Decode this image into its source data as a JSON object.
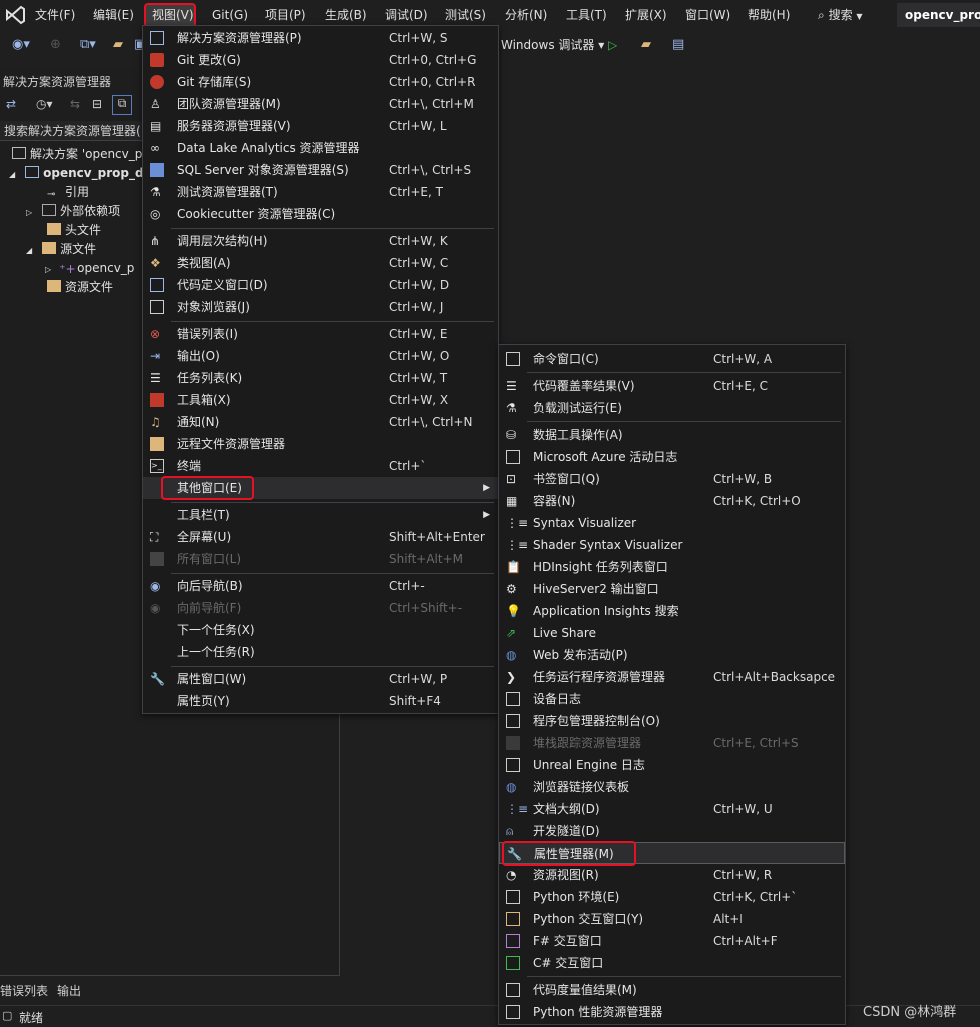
{
  "menubar": {
    "items": [
      "文件(F)",
      "编辑(E)",
      "视图(V)",
      "Git(G)",
      "项目(P)",
      "生成(B)",
      "调试(D)",
      "测试(S)",
      "分析(N)",
      "工具(T)",
      "扩展(X)",
      "窗口(W)",
      "帮助(H)"
    ],
    "search": "搜索",
    "search_icon": "search-icon",
    "project_tab": "opencv_prop"
  },
  "toolbar": {
    "run_label": "Windows 调试器"
  },
  "solution_explorer": {
    "title": "解决方案资源管理器",
    "search_placeholder": "搜索解决方案资源管理器(",
    "tree": [
      "解决方案 'opencv_p",
      "opencv_prop_d",
      "引用",
      "外部依赖项",
      "头文件",
      "源文件",
      "opencv_p",
      "资源文件"
    ]
  },
  "view_menu": {
    "items": [
      {
        "label": "解决方案资源管理器(P)",
        "shortcut": "Ctrl+W, S",
        "icon": "solution-explorer-icon"
      },
      {
        "label": "Git 更改(G)",
        "shortcut": "Ctrl+0, Ctrl+G",
        "icon": "git-changes-icon"
      },
      {
        "label": "Git 存储库(S)",
        "shortcut": "Ctrl+0, Ctrl+R",
        "icon": "git-repo-icon"
      },
      {
        "label": "团队资源管理器(M)",
        "shortcut": "Ctrl+\\, Ctrl+M",
        "icon": "team-explorer-icon"
      },
      {
        "label": "服务器资源管理器(V)",
        "shortcut": "Ctrl+W, L",
        "icon": "server-explorer-icon"
      },
      {
        "label": "Data Lake Analytics 资源管理器",
        "shortcut": "",
        "icon": "data-lake-icon"
      },
      {
        "label": "SQL Server 对象资源管理器(S)",
        "shortcut": "Ctrl+\\, Ctrl+S",
        "icon": "sql-server-icon"
      },
      {
        "label": "测试资源管理器(T)",
        "shortcut": "Ctrl+E, T",
        "icon": "test-explorer-icon"
      },
      {
        "label": "Cookiecutter 资源管理器(C)",
        "shortcut": "",
        "icon": "cookiecutter-icon"
      },
      {
        "label": "调用层次结构(H)",
        "shortcut": "Ctrl+W, K",
        "icon": "call-hierarchy-icon"
      },
      {
        "label": "类视图(A)",
        "shortcut": "Ctrl+W, C",
        "icon": "class-view-icon"
      },
      {
        "label": "代码定义窗口(D)",
        "shortcut": "Ctrl+W, D",
        "icon": "code-definition-icon"
      },
      {
        "label": "对象浏览器(J)",
        "shortcut": "Ctrl+W, J",
        "icon": "object-browser-icon"
      },
      {
        "label": "错误列表(I)",
        "shortcut": "Ctrl+W, E",
        "icon": "error-list-icon"
      },
      {
        "label": "输出(O)",
        "shortcut": "Ctrl+W, O",
        "icon": "output-icon"
      },
      {
        "label": "任务列表(K)",
        "shortcut": "Ctrl+W, T",
        "icon": "task-list-icon"
      },
      {
        "label": "工具箱(X)",
        "shortcut": "Ctrl+W, X",
        "icon": "toolbox-icon"
      },
      {
        "label": "通知(N)",
        "shortcut": "Ctrl+\\, Ctrl+N",
        "icon": "bell-icon"
      },
      {
        "label": "远程文件资源管理器",
        "shortcut": "",
        "icon": "remote-files-icon"
      },
      {
        "label": "终端",
        "shortcut": "Ctrl+`",
        "icon": "terminal-icon"
      },
      {
        "label": "其他窗口(E)",
        "shortcut": "",
        "icon": ""
      },
      {
        "label": "工具栏(T)",
        "shortcut": "",
        "icon": ""
      },
      {
        "label": "全屏幕(U)",
        "shortcut": "Shift+Alt+Enter",
        "icon": "fullscreen-icon"
      },
      {
        "label": "所有窗口(L)",
        "shortcut": "Shift+Alt+M",
        "icon": "all-windows-icon"
      },
      {
        "label": "向后导航(B)",
        "shortcut": "Ctrl+-",
        "icon": "navigate-back-icon"
      },
      {
        "label": "向前导航(F)",
        "shortcut": "Ctrl+Shift+-",
        "icon": "navigate-forward-icon"
      },
      {
        "label": "下一个任务(X)",
        "shortcut": "",
        "icon": ""
      },
      {
        "label": "上一个任务(R)",
        "shortcut": "",
        "icon": ""
      },
      {
        "label": "属性窗口(W)",
        "shortcut": "Ctrl+W, P",
        "icon": "wrench-icon"
      },
      {
        "label": "属性页(Y)",
        "shortcut": "Shift+F4",
        "icon": ""
      }
    ]
  },
  "other_windows_menu": {
    "items": [
      {
        "label": "命令窗口(C)",
        "shortcut": "Ctrl+W, A",
        "icon": "command-window-icon"
      },
      {
        "label": "代码覆盖率结果(V)",
        "shortcut": "Ctrl+E, C",
        "icon": "code-coverage-icon"
      },
      {
        "label": "负载测试运行(E)",
        "shortcut": "",
        "icon": "load-test-icon"
      },
      {
        "label": "数据工具操作(A)",
        "shortcut": "",
        "icon": "data-tools-icon"
      },
      {
        "label": "Microsoft Azure 活动日志",
        "shortcut": "",
        "icon": "azure-log-icon"
      },
      {
        "label": "书签窗口(Q)",
        "shortcut": "Ctrl+W, B",
        "icon": "bookmark-icon"
      },
      {
        "label": "容器(N)",
        "shortcut": "Ctrl+K, Ctrl+O",
        "icon": "container-icon"
      },
      {
        "label": "Syntax Visualizer",
        "shortcut": "",
        "icon": "syntax-visualizer-icon"
      },
      {
        "label": "Shader Syntax Visualizer",
        "shortcut": "",
        "icon": "shader-syntax-icon"
      },
      {
        "label": "HDInsight 任务列表窗口",
        "shortcut": "",
        "icon": "hdinsight-icon"
      },
      {
        "label": "HiveServer2 输出窗口",
        "shortcut": "",
        "icon": "hiveserver-icon"
      },
      {
        "label": "Application Insights 搜索",
        "shortcut": "",
        "icon": "app-insights-icon"
      },
      {
        "label": "Live Share",
        "shortcut": "",
        "icon": "live-share-icon"
      },
      {
        "label": "Web 发布活动(P)",
        "shortcut": "",
        "icon": "web-publish-icon"
      },
      {
        "label": "任务运行程序资源管理器",
        "shortcut": "Ctrl+Alt+Backsapce",
        "icon": "task-runner-icon"
      },
      {
        "label": "设备日志",
        "shortcut": "",
        "icon": "device-log-icon"
      },
      {
        "label": "程序包管理器控制台(O)",
        "shortcut": "",
        "icon": "package-console-icon"
      },
      {
        "label": "堆栈跟踪资源管理器",
        "shortcut": "Ctrl+E, Ctrl+S",
        "icon": "stack-trace-icon"
      },
      {
        "label": "Unreal Engine 日志",
        "shortcut": "",
        "icon": "unreal-log-icon"
      },
      {
        "label": "浏览器链接仪表板",
        "shortcut": "",
        "icon": "browser-link-icon"
      },
      {
        "label": "文档大纲(D)",
        "shortcut": "Ctrl+W, U",
        "icon": "document-outline-icon"
      },
      {
        "label": "开发隧道(D)",
        "shortcut": "",
        "icon": "dev-tunnel-icon"
      },
      {
        "label": "属性管理器(M)",
        "shortcut": "",
        "icon": "wrench-icon"
      },
      {
        "label": "资源视图(R)",
        "shortcut": "Ctrl+W, R",
        "icon": "resource-view-icon"
      },
      {
        "label": "Python 环境(E)",
        "shortcut": "Ctrl+K, Ctrl+`",
        "icon": "python-env-icon"
      },
      {
        "label": "Python 交互窗口(Y)",
        "shortcut": "Alt+I",
        "icon": "python-interactive-icon"
      },
      {
        "label": "F# 交互窗口",
        "shortcut": "Ctrl+Alt+F",
        "icon": "fsharp-interactive-icon"
      },
      {
        "label": "C# 交互窗口",
        "shortcut": "",
        "icon": "csharp-interactive-icon"
      },
      {
        "label": "代码度量值结果(M)",
        "shortcut": "",
        "icon": "code-metrics-icon"
      },
      {
        "label": "Python 性能资源管理器",
        "shortcut": "",
        "icon": "python-perf-icon"
      }
    ]
  },
  "bottom": {
    "tabs": [
      "错误列表",
      "输出"
    ],
    "status": "就绪",
    "watermark": "CSDN @林鸿群"
  },
  "colors": {
    "accent": "#e81123",
    "menu_bg": "#1b1b1c",
    "ide_bg": "#1f1f1f"
  }
}
